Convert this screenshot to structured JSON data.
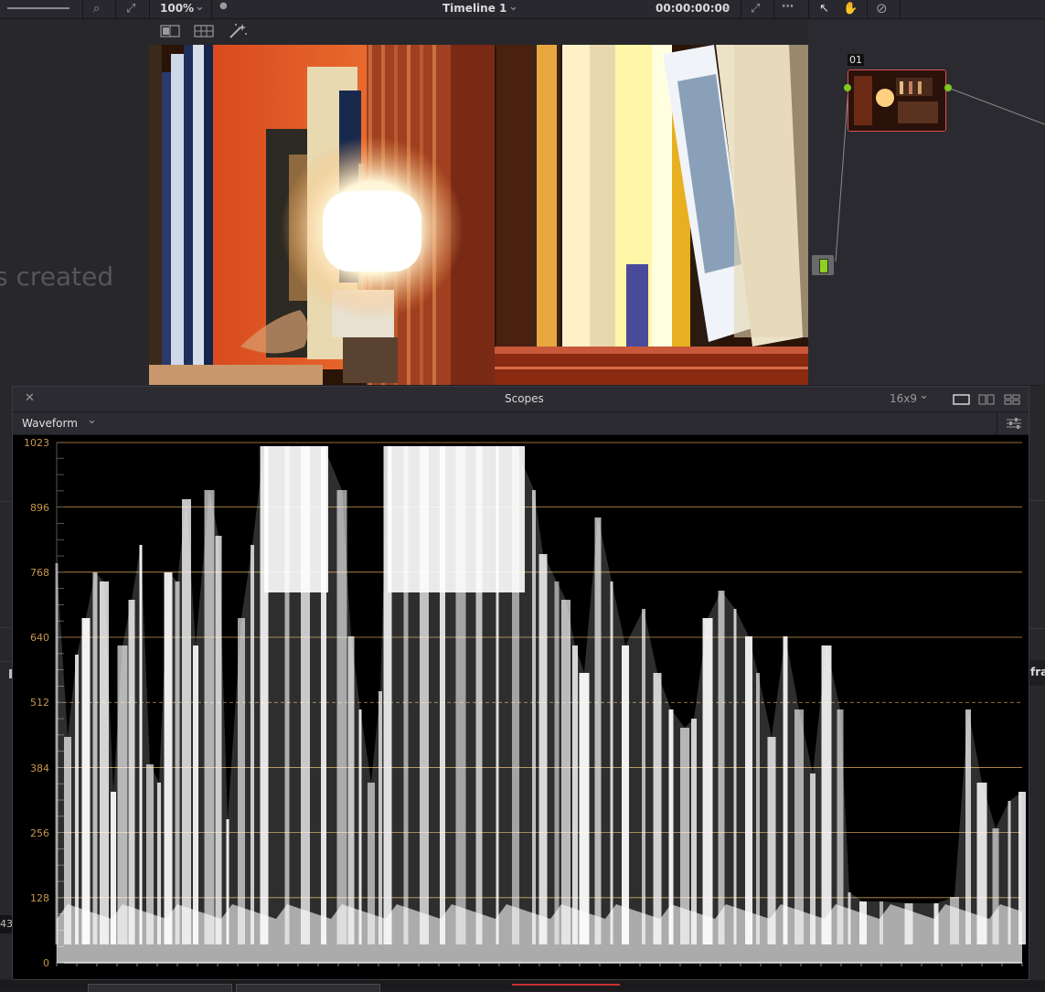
{
  "toolbar": {
    "zoom": "100%",
    "timeline": "Timeline 1",
    "timecode": "00:00:00:00"
  },
  "left_panel": {
    "ghost_text": "s created",
    "edge_value": "43"
  },
  "node_panel": {
    "node_label": "01"
  },
  "scopes": {
    "title": "Scopes",
    "aspect": "16x9",
    "mode": "Waveform",
    "axis_labels": [
      "1023",
      "896",
      "768",
      "640",
      "512",
      "384",
      "256",
      "128",
      "0"
    ]
  },
  "right_edge_text": "fra",
  "colors": {
    "graticule": "#c7974a",
    "node_border": "#e05252",
    "node_dot": "#7ec820",
    "trace": "#ffffff"
  }
}
